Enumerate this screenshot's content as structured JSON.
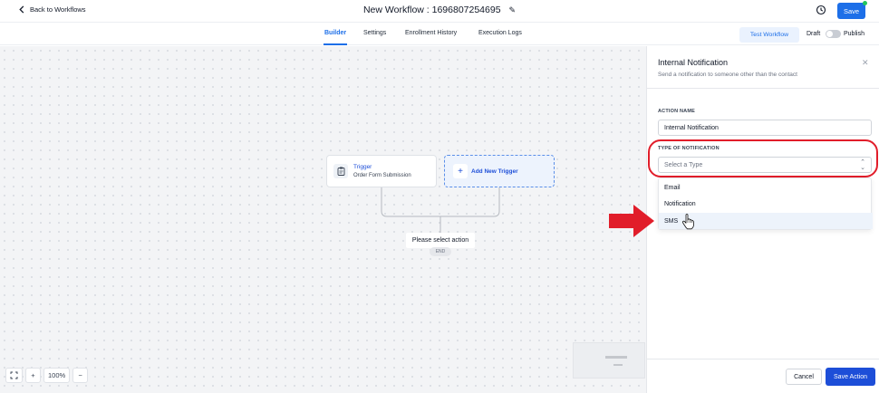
{
  "header": {
    "back_label": "Back to Workflows",
    "workflow_title": "New Workflow : 1696807254695",
    "save_label": "Save"
  },
  "tabs": [
    {
      "label": "Builder",
      "active": true
    },
    {
      "label": "Settings",
      "active": false
    },
    {
      "label": "Enrollment History",
      "active": false
    },
    {
      "label": "Execution Logs",
      "active": false
    }
  ],
  "toolbar": {
    "test_workflow_label": "Test Workflow",
    "draft_label": "Draft",
    "publish_label": "Publish",
    "publish_toggle_on": false
  },
  "canvas": {
    "trigger": {
      "title": "Trigger",
      "subtitle": "Order Form Submission",
      "icon": "clipboard-icon"
    },
    "add_trigger": {
      "label": "Add New Trigger",
      "icon": "plus-icon"
    },
    "select_action_label": "Please select action",
    "end_label": "END"
  },
  "zoom": {
    "fit_icon": "fit-screen-icon",
    "zoom_in": "+",
    "level": "100%",
    "zoom_out": "−"
  },
  "panel": {
    "title": "Internal Notification",
    "subtitle": "Send a notification to someone other than the contact",
    "action_name_label": "ACTION NAME",
    "action_name_value": "Internal Notification",
    "type_label": "TYPE OF NOTIFICATION",
    "type_placeholder": "Select a Type",
    "type_options": [
      "Email",
      "Notification",
      "SMS"
    ],
    "hovered_option": "SMS",
    "cancel_label": "Cancel",
    "save_action_label": "Save Action"
  },
  "colors": {
    "accent": "#1d6fe8",
    "annotation_red": "#e11d2a",
    "status_dot": "#22c55e"
  }
}
